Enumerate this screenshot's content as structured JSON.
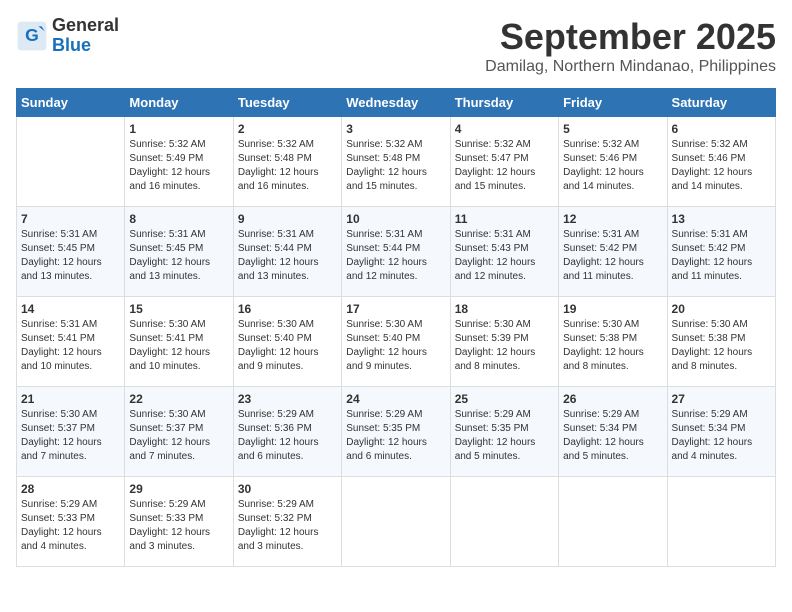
{
  "header": {
    "logo_line1": "General",
    "logo_line2": "Blue",
    "month": "September 2025",
    "location": "Damilag, Northern Mindanao, Philippines"
  },
  "days_of_week": [
    "Sunday",
    "Monday",
    "Tuesday",
    "Wednesday",
    "Thursday",
    "Friday",
    "Saturday"
  ],
  "weeks": [
    [
      {
        "num": "",
        "sunrise": "",
        "sunset": "",
        "daylight": ""
      },
      {
        "num": "1",
        "sunrise": "Sunrise: 5:32 AM",
        "sunset": "Sunset: 5:49 PM",
        "daylight": "Daylight: 12 hours and 16 minutes."
      },
      {
        "num": "2",
        "sunrise": "Sunrise: 5:32 AM",
        "sunset": "Sunset: 5:48 PM",
        "daylight": "Daylight: 12 hours and 16 minutes."
      },
      {
        "num": "3",
        "sunrise": "Sunrise: 5:32 AM",
        "sunset": "Sunset: 5:48 PM",
        "daylight": "Daylight: 12 hours and 15 minutes."
      },
      {
        "num": "4",
        "sunrise": "Sunrise: 5:32 AM",
        "sunset": "Sunset: 5:47 PM",
        "daylight": "Daylight: 12 hours and 15 minutes."
      },
      {
        "num": "5",
        "sunrise": "Sunrise: 5:32 AM",
        "sunset": "Sunset: 5:46 PM",
        "daylight": "Daylight: 12 hours and 14 minutes."
      },
      {
        "num": "6",
        "sunrise": "Sunrise: 5:32 AM",
        "sunset": "Sunset: 5:46 PM",
        "daylight": "Daylight: 12 hours and 14 minutes."
      }
    ],
    [
      {
        "num": "7",
        "sunrise": "Sunrise: 5:31 AM",
        "sunset": "Sunset: 5:45 PM",
        "daylight": "Daylight: 12 hours and 13 minutes."
      },
      {
        "num": "8",
        "sunrise": "Sunrise: 5:31 AM",
        "sunset": "Sunset: 5:45 PM",
        "daylight": "Daylight: 12 hours and 13 minutes."
      },
      {
        "num": "9",
        "sunrise": "Sunrise: 5:31 AM",
        "sunset": "Sunset: 5:44 PM",
        "daylight": "Daylight: 12 hours and 13 minutes."
      },
      {
        "num": "10",
        "sunrise": "Sunrise: 5:31 AM",
        "sunset": "Sunset: 5:44 PM",
        "daylight": "Daylight: 12 hours and 12 minutes."
      },
      {
        "num": "11",
        "sunrise": "Sunrise: 5:31 AM",
        "sunset": "Sunset: 5:43 PM",
        "daylight": "Daylight: 12 hours and 12 minutes."
      },
      {
        "num": "12",
        "sunrise": "Sunrise: 5:31 AM",
        "sunset": "Sunset: 5:42 PM",
        "daylight": "Daylight: 12 hours and 11 minutes."
      },
      {
        "num": "13",
        "sunrise": "Sunrise: 5:31 AM",
        "sunset": "Sunset: 5:42 PM",
        "daylight": "Daylight: 12 hours and 11 minutes."
      }
    ],
    [
      {
        "num": "14",
        "sunrise": "Sunrise: 5:31 AM",
        "sunset": "Sunset: 5:41 PM",
        "daylight": "Daylight: 12 hours and 10 minutes."
      },
      {
        "num": "15",
        "sunrise": "Sunrise: 5:30 AM",
        "sunset": "Sunset: 5:41 PM",
        "daylight": "Daylight: 12 hours and 10 minutes."
      },
      {
        "num": "16",
        "sunrise": "Sunrise: 5:30 AM",
        "sunset": "Sunset: 5:40 PM",
        "daylight": "Daylight: 12 hours and 9 minutes."
      },
      {
        "num": "17",
        "sunrise": "Sunrise: 5:30 AM",
        "sunset": "Sunset: 5:40 PM",
        "daylight": "Daylight: 12 hours and 9 minutes."
      },
      {
        "num": "18",
        "sunrise": "Sunrise: 5:30 AM",
        "sunset": "Sunset: 5:39 PM",
        "daylight": "Daylight: 12 hours and 8 minutes."
      },
      {
        "num": "19",
        "sunrise": "Sunrise: 5:30 AM",
        "sunset": "Sunset: 5:38 PM",
        "daylight": "Daylight: 12 hours and 8 minutes."
      },
      {
        "num": "20",
        "sunrise": "Sunrise: 5:30 AM",
        "sunset": "Sunset: 5:38 PM",
        "daylight": "Daylight: 12 hours and 8 minutes."
      }
    ],
    [
      {
        "num": "21",
        "sunrise": "Sunrise: 5:30 AM",
        "sunset": "Sunset: 5:37 PM",
        "daylight": "Daylight: 12 hours and 7 minutes."
      },
      {
        "num": "22",
        "sunrise": "Sunrise: 5:30 AM",
        "sunset": "Sunset: 5:37 PM",
        "daylight": "Daylight: 12 hours and 7 minutes."
      },
      {
        "num": "23",
        "sunrise": "Sunrise: 5:29 AM",
        "sunset": "Sunset: 5:36 PM",
        "daylight": "Daylight: 12 hours and 6 minutes."
      },
      {
        "num": "24",
        "sunrise": "Sunrise: 5:29 AM",
        "sunset": "Sunset: 5:35 PM",
        "daylight": "Daylight: 12 hours and 6 minutes."
      },
      {
        "num": "25",
        "sunrise": "Sunrise: 5:29 AM",
        "sunset": "Sunset: 5:35 PM",
        "daylight": "Daylight: 12 hours and 5 minutes."
      },
      {
        "num": "26",
        "sunrise": "Sunrise: 5:29 AM",
        "sunset": "Sunset: 5:34 PM",
        "daylight": "Daylight: 12 hours and 5 minutes."
      },
      {
        "num": "27",
        "sunrise": "Sunrise: 5:29 AM",
        "sunset": "Sunset: 5:34 PM",
        "daylight": "Daylight: 12 hours and 4 minutes."
      }
    ],
    [
      {
        "num": "28",
        "sunrise": "Sunrise: 5:29 AM",
        "sunset": "Sunset: 5:33 PM",
        "daylight": "Daylight: 12 hours and 4 minutes."
      },
      {
        "num": "29",
        "sunrise": "Sunrise: 5:29 AM",
        "sunset": "Sunset: 5:33 PM",
        "daylight": "Daylight: 12 hours and 3 minutes."
      },
      {
        "num": "30",
        "sunrise": "Sunrise: 5:29 AM",
        "sunset": "Sunset: 5:32 PM",
        "daylight": "Daylight: 12 hours and 3 minutes."
      },
      {
        "num": "",
        "sunrise": "",
        "sunset": "",
        "daylight": ""
      },
      {
        "num": "",
        "sunrise": "",
        "sunset": "",
        "daylight": ""
      },
      {
        "num": "",
        "sunrise": "",
        "sunset": "",
        "daylight": ""
      },
      {
        "num": "",
        "sunrise": "",
        "sunset": "",
        "daylight": ""
      }
    ]
  ]
}
